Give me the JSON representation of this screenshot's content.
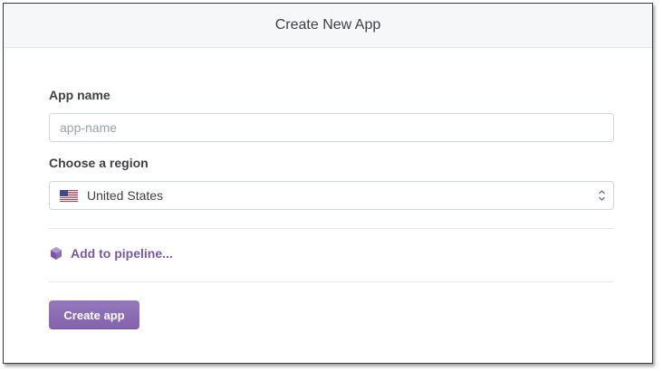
{
  "dialog": {
    "title": "Create New App"
  },
  "form": {
    "app_name_label": "App name",
    "app_name_placeholder": "app-name",
    "app_name_value": "",
    "region_label": "Choose a region",
    "region_value": "United States",
    "region_flag_icon": "us-flag-icon",
    "pipeline_label": "Add to pipeline...",
    "pipeline_icon": "pipeline-hexagon-icon",
    "submit_label": "Create app"
  },
  "colors": {
    "accent": "#79589f",
    "button": "#8b6fb3",
    "header_bg": "#f6f7f9",
    "border": "#cfd6de"
  }
}
